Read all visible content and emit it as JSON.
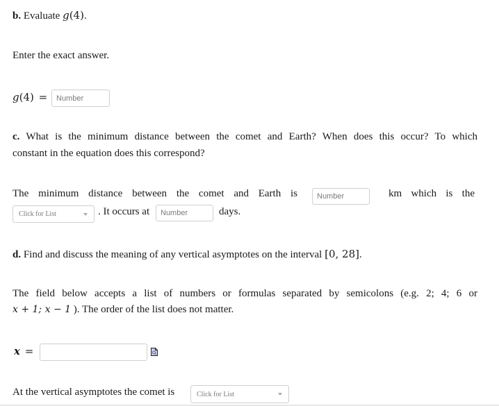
{
  "part_b": {
    "label": "b.",
    "text": "Evaluate",
    "func": "g",
    "arg": "(4)",
    "end": ".",
    "instruction": "Enter the exact answer.",
    "answer_lhs_func": "g",
    "answer_lhs_arg": "(4)",
    "equals": "=",
    "answer_placeholder": "Number"
  },
  "part_c": {
    "label": "c.",
    "question_line1": "What is the minimum distance between the comet and Earth? When does this occur? To which",
    "question_line2": "constant in the equation does this correspond?",
    "sentence_part1": "The minimum distance between the comet and Earth is",
    "distance_placeholder": "Number",
    "sentence_part2": "km which is the",
    "constant_select_label": "Click for List",
    "sentence_part3": ". It occurs at",
    "time_placeholder": "Number",
    "sentence_part4": "days."
  },
  "part_d": {
    "label": "d.",
    "question": "Find and discuss the meaning of any vertical asymptotes on the interval",
    "interval": "[0, 28]",
    "question_end": ".",
    "note_line1": "The field below accepts a list of numbers or formulas separated by semicolons (e.g. 2; 4; 6 or",
    "note_line2_math": "x + 1;  x − 1",
    "note_line2_text": "). The order of the list does not matter.",
    "x_label": "x",
    "equals": "=",
    "x_value": "",
    "preview_icon": "preview-icon",
    "asymptote_sentence": "At the vertical asymptotes the comet is",
    "asymptote_select_label": "Click for List"
  }
}
